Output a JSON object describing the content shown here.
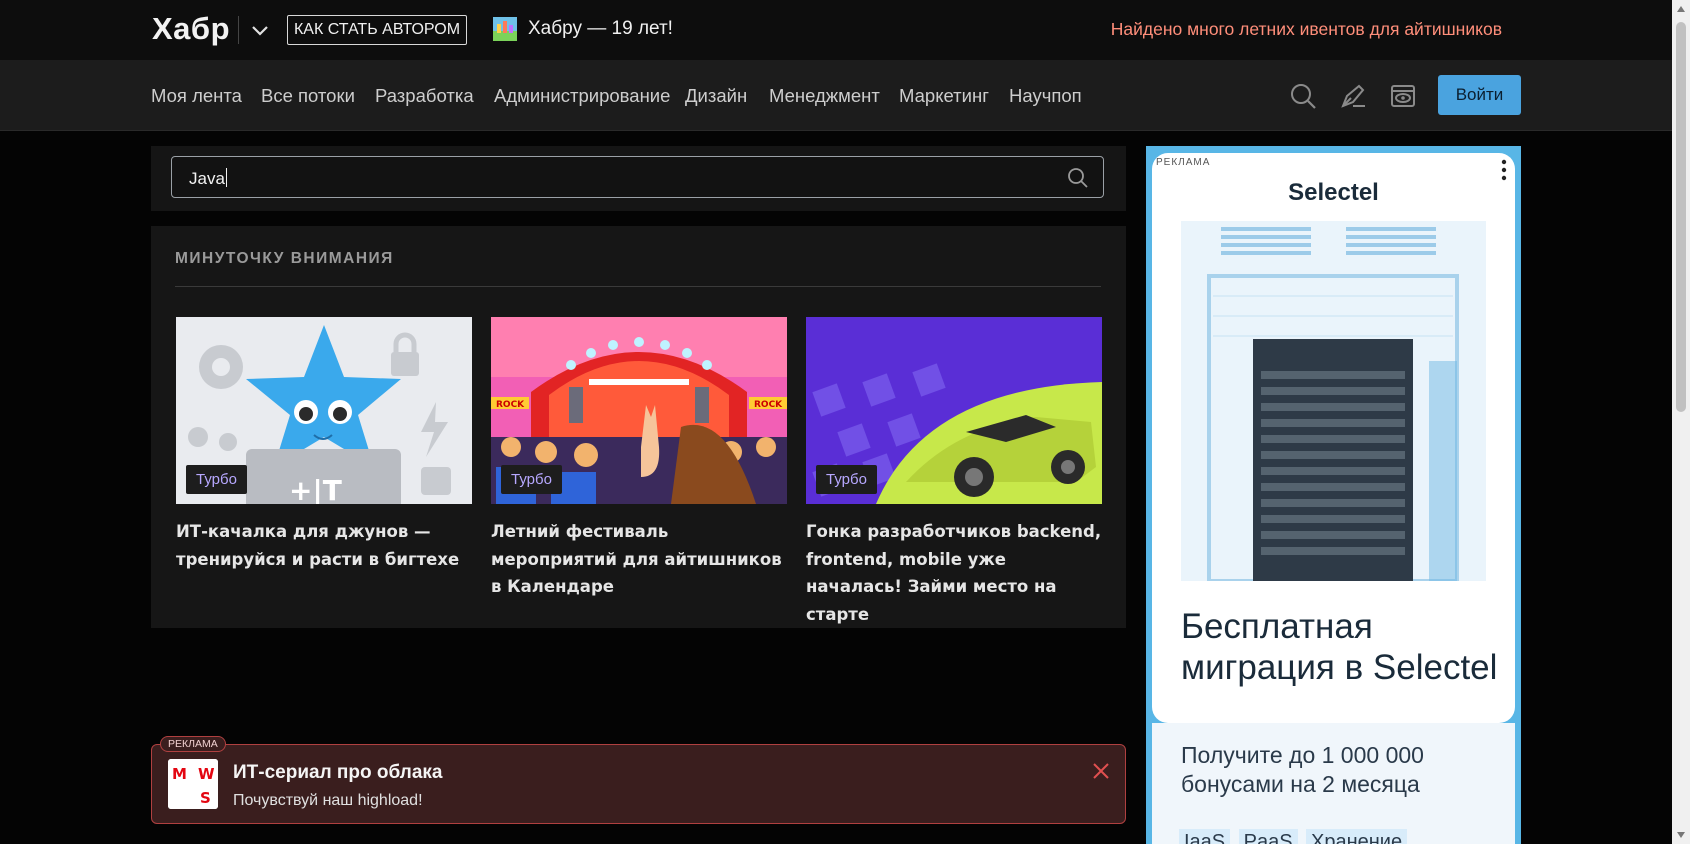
{
  "header": {
    "logo": "Хабр",
    "become_author": "КАК СТАТЬ АВТОРОМ",
    "anniversary": "Хабру — 19 лет!",
    "promo_link": "Найдено много летних ивентов для айтишников"
  },
  "nav": {
    "items": [
      "Моя лента",
      "Все потоки",
      "Разработка",
      "Администрирование",
      "Дизайн",
      "Менеджмент",
      "Маркетинг",
      "Научпоп"
    ],
    "login": "Войти"
  },
  "search": {
    "value": "Java"
  },
  "attention": {
    "title": "МИНУТОЧКУ ВНИМАНИЯ",
    "cards": [
      {
        "tag": "Турбо",
        "title": "ИТ-качалка для джунов — тренируйся и расти в бигтехе"
      },
      {
        "tag": "Турбо",
        "title": "Летний фестиваль мероприятий для айтишников в Календаре"
      },
      {
        "tag": "Турбо",
        "title": "Гонка разработчиков backend, frontend, mobile уже началась! Займи место на старте"
      }
    ]
  },
  "bottom_ad": {
    "label": "РЕКЛАМА",
    "title": "ИТ-сериал про облака",
    "subtitle": "Почувствуй наш highload!"
  },
  "side_ad": {
    "label": "РЕКЛАМА",
    "brand": "Selectel",
    "headline": "Бесплатная миграция в Selectel",
    "subtitle": "Получите до 1 000 000 бонусами на 2 месяца",
    "tags": [
      "IaaS",
      "PaaS",
      "Хранение"
    ]
  },
  "colors": {
    "accent": "#4aa3df",
    "promo": "#ff8e7a",
    "tag_text": "#b7a8ff"
  }
}
